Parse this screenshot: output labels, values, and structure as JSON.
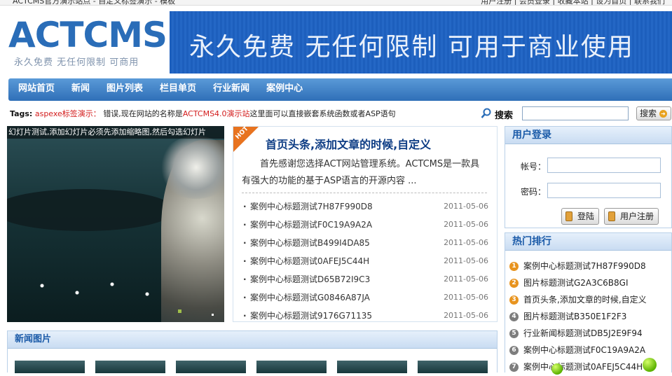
{
  "topbar": {
    "left": "ACTCMS官方演示站点 - 自定义标签演示 - 模板",
    "right": "用户注册 | 会员登录 | 收藏本站 | 设为首页 | 联系我们"
  },
  "logo": {
    "text": "ACTCMS",
    "slogan": "永久免费 无任何限制 可商用"
  },
  "banner": {
    "text": "永久免费 无任何限制 可用于商业使用"
  },
  "nav": {
    "items": [
      {
        "label": "网站首页"
      },
      {
        "label": "新闻"
      },
      {
        "label": "图片列表"
      },
      {
        "label": "栏目单页"
      },
      {
        "label": "行业新闻"
      },
      {
        "label": "案例中心"
      }
    ]
  },
  "tags": {
    "label": "Tags:",
    "demo": "aspexe标签演示：",
    "text1": "错误,现在网站的名称是",
    "site": "ACTCMS4.0演示站",
    "text2": "这里面可以直接嵌套系统函数或者ASP语句"
  },
  "search": {
    "label": "搜索",
    "value": "",
    "button": "搜索"
  },
  "slide": {
    "caption": "幻灯片测试,添加幻灯片必须先添加缩略图,然后勾选幻灯片"
  },
  "headline": {
    "hot": "HOT",
    "title": "首页头条,添加文章的时候,自定义",
    "intro": "首先感谢您选择ACT网站管理系统。ACTCMS是一款具有强大的功能的基于ASP语言的开源内容 ...",
    "news": [
      {
        "title": "案例中心标题测试7H87F990D8",
        "date": "2011-05-06"
      },
      {
        "title": "案例中心标题测试F0C19A9A2A",
        "date": "2011-05-06"
      },
      {
        "title": "案例中心标题测试B499I4DA85",
        "date": "2011-05-06"
      },
      {
        "title": "案例中心标题测试0AFEJ5C44H",
        "date": "2011-05-06"
      },
      {
        "title": "案例中心标题测试D65B72I9C3",
        "date": "2011-05-06"
      },
      {
        "title": "案例中心标题测试G0846A87JA",
        "date": "2011-05-06"
      },
      {
        "title": "案例中心标题测试9176G71135",
        "date": "2011-05-06"
      }
    ]
  },
  "login": {
    "title": "用户登录",
    "account_label": "帐号：",
    "password_label": "密码：",
    "login_button": "登陆",
    "register_button": "用户注册"
  },
  "hot_rank": {
    "title": "热门排行",
    "items": [
      {
        "n": "1",
        "title": "案例中心标题测试7H87F990D8"
      },
      {
        "n": "2",
        "title": "图片标题测试G2A3C6B8GI"
      },
      {
        "n": "3",
        "title": "首页头条,添加文章的时候,自定义"
      },
      {
        "n": "4",
        "title": "图片标题测试B350E1F2F3"
      },
      {
        "n": "5",
        "title": "行业新闻标题测试DB5J2E9F94"
      },
      {
        "n": "6",
        "title": "案例中心标题测试F0C19A9A2A"
      },
      {
        "n": "7",
        "title": "案例中心标题测试0AFEJ5C44H"
      }
    ]
  },
  "news_images": {
    "title": "新闻图片"
  },
  "colors": {
    "brand": "#2a6db8",
    "nav": "#3f80c6",
    "red": "#d31c1c",
    "orange": "#e8731f"
  }
}
